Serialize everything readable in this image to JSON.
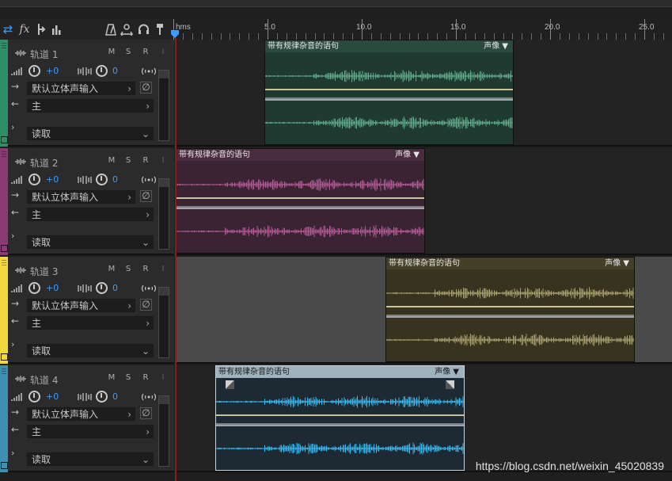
{
  "toolbar": {
    "icons": [
      "loop-icon",
      "fx-icon",
      "routing-icon",
      "meter-icon",
      "metronome-icon",
      "stretch-icon",
      "headphones-icon",
      "pin-icon"
    ],
    "fx_label": "fx"
  },
  "ruler": {
    "unit": "hms",
    "ticks": [
      "5.0",
      "10.0",
      "15.0",
      "20.0",
      "25.0"
    ]
  },
  "colors": {
    "track1": "#2f8e67",
    "track2": "#8a3c72",
    "track3": "#f2d740",
    "track4": "#3f8fb0",
    "accent_blue": "#3b9cff",
    "playhead": "#b01e1e"
  },
  "tracks": [
    {
      "name": "轨道 1",
      "m": "M",
      "s": "S",
      "r": "R",
      "i": "I",
      "volume": "+0",
      "pan": "0",
      "input": "默认立体声输入",
      "output": "主",
      "mode": "读取",
      "clip": {
        "title": "带有规律杂音的语句",
        "menu": "声像 ▼"
      }
    },
    {
      "name": "轨道 2",
      "m": "M",
      "s": "S",
      "r": "R",
      "i": "I",
      "volume": "+0",
      "pan": "0",
      "input": "默认立体声输入",
      "output": "主",
      "mode": "读取",
      "clip": {
        "title": "带有规律杂音的语句",
        "menu": "声像 ▼"
      }
    },
    {
      "name": "轨道 3",
      "m": "M",
      "s": "S",
      "r": "R",
      "i": "I",
      "volume": "+0",
      "pan": "0",
      "input": "默认立体声输入",
      "output": "主",
      "mode": "读取",
      "clip": {
        "title": "带有规律杂音的语句",
        "menu": "声像 ▼"
      }
    },
    {
      "name": "轨道 4",
      "m": "M",
      "s": "S",
      "r": "R",
      "i": "I",
      "volume": "+0",
      "pan": "0",
      "input": "默认立体声输入",
      "output": "主",
      "mode": "读取",
      "clip": {
        "title": "带有规律杂音的语句",
        "menu": "声像 ▼"
      }
    }
  ],
  "watermark": "https://blog.csdn.net/weixin_45020839"
}
